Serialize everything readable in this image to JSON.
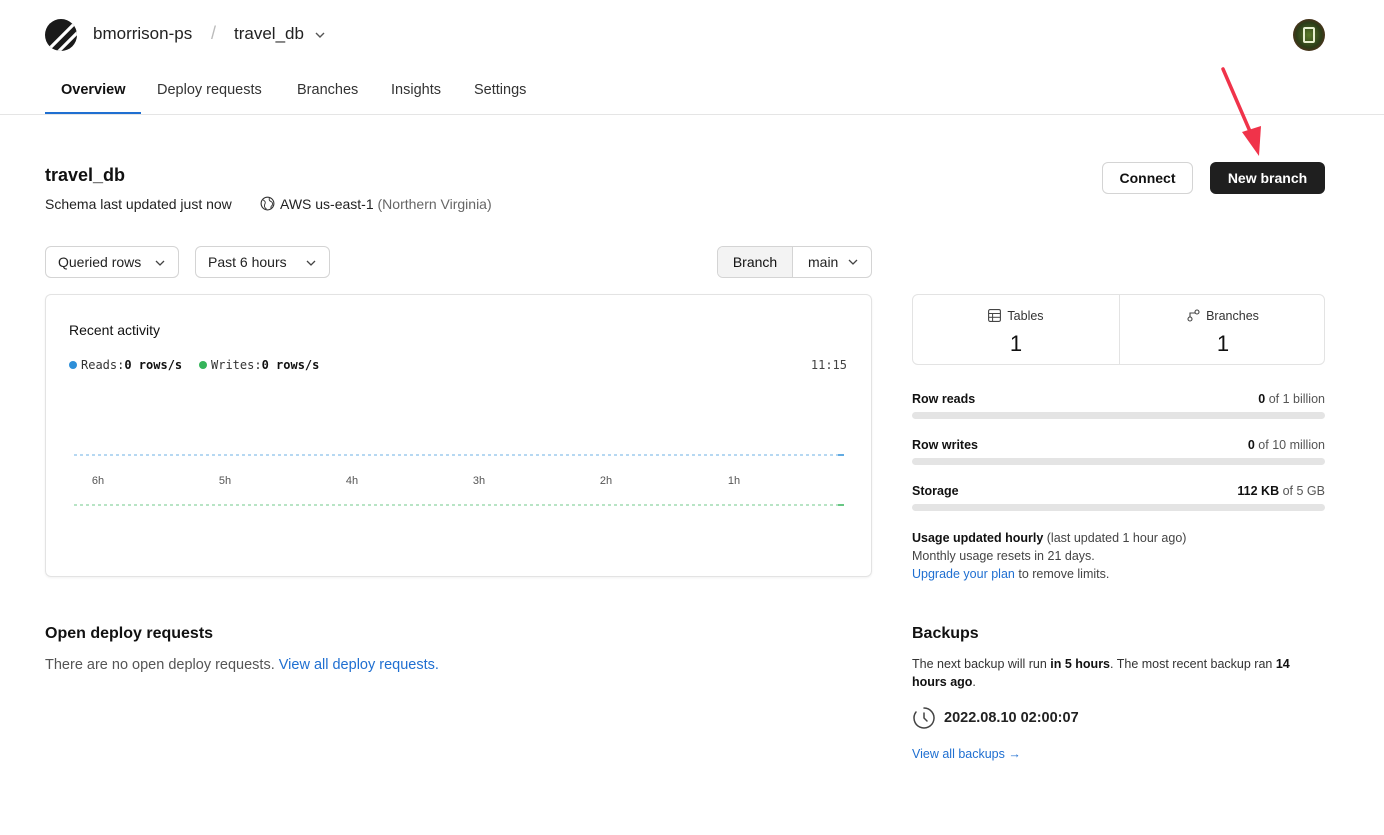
{
  "header": {
    "org": "bmorrison-ps",
    "separator": "/",
    "database": "travel_db"
  },
  "nav": {
    "tabs": [
      "Overview",
      "Deploy requests",
      "Branches",
      "Insights",
      "Settings"
    ],
    "active": "Overview"
  },
  "page": {
    "title": "travel_db",
    "schema_status": "Schema last updated just now",
    "region": "AWS us-east-1",
    "region_detail": "(Northern Virginia)",
    "connect_label": "Connect",
    "new_branch_label": "New branch"
  },
  "filters": {
    "metric": "Queried rows",
    "range": "Past 6 hours",
    "branch_label": "Branch",
    "branch_value": "main"
  },
  "activity": {
    "title": "Recent activity",
    "reads_label": "Reads:",
    "reads_value": "0 rows/s",
    "writes_label": "Writes:",
    "writes_value": "0 rows/s",
    "time": "11:15",
    "colors": {
      "reads": "#2e8fd8",
      "writes": "#35b45a"
    }
  },
  "chart_data": {
    "type": "line",
    "x": [
      "6h",
      "5h",
      "4h",
      "3h",
      "2h",
      "1h"
    ],
    "series": [
      {
        "name": "Reads",
        "values": [
          0,
          0,
          0,
          0,
          0,
          0
        ]
      },
      {
        "name": "Writes",
        "values": [
          0,
          0,
          0,
          0,
          0,
          0
        ]
      }
    ]
  },
  "stats": {
    "tables_label": "Tables",
    "tables_value": "1",
    "branches_label": "Branches",
    "branches_value": "1"
  },
  "usage": {
    "row_reads": {
      "label": "Row reads",
      "used": "0",
      "limit": "of 1 billion",
      "fraction": 0
    },
    "row_writes": {
      "label": "Row writes",
      "used": "0",
      "limit": "of 10 million",
      "fraction": 0
    },
    "storage": {
      "label": "Storage",
      "used": "112 KB",
      "limit": "of 5 GB",
      "fraction": 0
    },
    "note_bold": "Usage updated hourly",
    "note_rest": "(last updated 1 hour ago)",
    "reset_text": "Monthly usage resets in 21 days.",
    "upgrade_link": "Upgrade your plan",
    "upgrade_rest": "to remove limits."
  },
  "deploy": {
    "title": "Open deploy requests",
    "empty_text": "There are no open deploy requests.",
    "link": "View all deploy requests."
  },
  "backups": {
    "title": "Backups",
    "text_1": "The next backup will run",
    "text_bold_1": "in 5 hours",
    "text_2": ". The most recent backup ran",
    "text_bold_2": "14 hours ago",
    "text_3": ".",
    "last_backup": "2022.08.10 02:00:07",
    "link": "View all backups →"
  }
}
